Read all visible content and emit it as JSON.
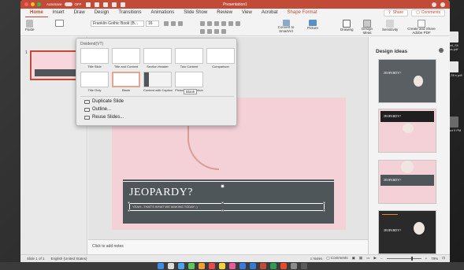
{
  "window": {
    "title": "Presentation1",
    "autosave_label": "AutoSave",
    "autosave_state": "OFF"
  },
  "tabs": [
    "Home",
    "Insert",
    "Draw",
    "Design",
    "Transitions",
    "Animations",
    "Slide Show",
    "Review",
    "View",
    "Acrobat",
    "Shape Format"
  ],
  "tabs_right": {
    "share": "Share",
    "comments": "Comments"
  },
  "ribbon": {
    "paste": "Paste",
    "font_name": "Franklin Gothic Book (B...",
    "font_size": "16",
    "convert_to_smartart": "Convert to SmartArt",
    "picture": "Picture",
    "drawing": "Drawing",
    "design_ideas": "Design Ideas",
    "sensitivity": "Sensitivity",
    "create_share_pdf": "Create and Share Adobe PDF"
  },
  "dropdown": {
    "header": "Dividend(VT)",
    "layouts": [
      "Title Slide",
      "Title and Content",
      "Section Header",
      "Two Content",
      "Comparison",
      "Title Only",
      "Blank",
      "Content with Caption",
      "Picture with Caption"
    ],
    "tooltip": "Blank",
    "items": [
      "Duplicate Slide",
      "Outline...",
      "Reuse Slides..."
    ]
  },
  "thumbs": {
    "slide_number": "1"
  },
  "slide": {
    "title": "JEOPARDY?",
    "subtitle": "YEAH...THAT'S WHAT WE MAKING TODAY ;)"
  },
  "notes": {
    "placeholder": "Click to add notes"
  },
  "design_ideas": {
    "header": "Design ideas",
    "idea_title": "JEOPARDY?"
  },
  "status": {
    "slide_of": "Slide 1 of 1",
    "language": "English (United States)",
    "notes": "Notes",
    "comments": "Comments",
    "zoom": "79%"
  },
  "desktop_files": [
    "od_Sli cs.pdf",
    "od_Sli e.pdf",
    "Shot 9 PM"
  ],
  "colors": {
    "accent": "#c14b37",
    "slide_bg": "#f4d0d7",
    "band": "#4f5659"
  }
}
